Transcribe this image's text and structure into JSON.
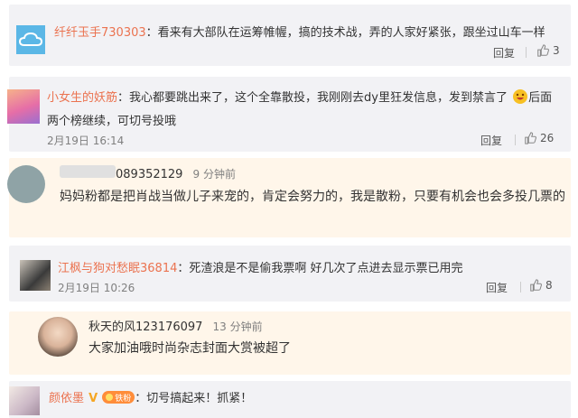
{
  "comments": [
    {
      "user": "纤纤玉手730303",
      "text": "：看来有大部队在运筹帷幄，搞的技术战，弄的人家好紧张，跟坐过山车一样",
      "reply_label": "回复",
      "likes": "3"
    },
    {
      "user": "小女生的妖筋",
      "text_line1": "：我心都要跳出来了，这个全靠散投，我刚刚去dy里狂发信息，发到禁言了",
      "text_line1_tail": "后面",
      "text_line2": "两个榜继续，可切号投哦",
      "time": "2月19日 16:14",
      "reply_label": "回复",
      "likes": "26"
    },
    {
      "user": "089352129",
      "time": "9 分钟前",
      "text": "妈妈粉都是把肖战当做儿子来宠的，肯定会努力的，我是散粉，只要有机会也会多投几票的"
    },
    {
      "user": "江枫与狗对愁眠36814",
      "text": "：死渣浪是不是偷我票啊 好几次了点进去显示票已用完",
      "time": "2月19日 10:26",
      "reply_label": "回复",
      "likes": "8"
    },
    {
      "user": "秋天的风123176097",
      "time": "13 分钟前",
      "text": "大家加油哦时尚杂志封面大赏被超了"
    },
    {
      "user": "颜依墨",
      "badge": "铁粉",
      "text": "：切号搞起来！抓紧！"
    }
  ],
  "colors": {
    "username": "#eb7350",
    "card_gray": "#f2f2f5",
    "card_peach": "#fff6ea"
  },
  "icons": [
    "cloud-icon",
    "thumbs-up-icon",
    "grin-emoji-icon",
    "verified-v-icon",
    "fan-badge-icon"
  ]
}
